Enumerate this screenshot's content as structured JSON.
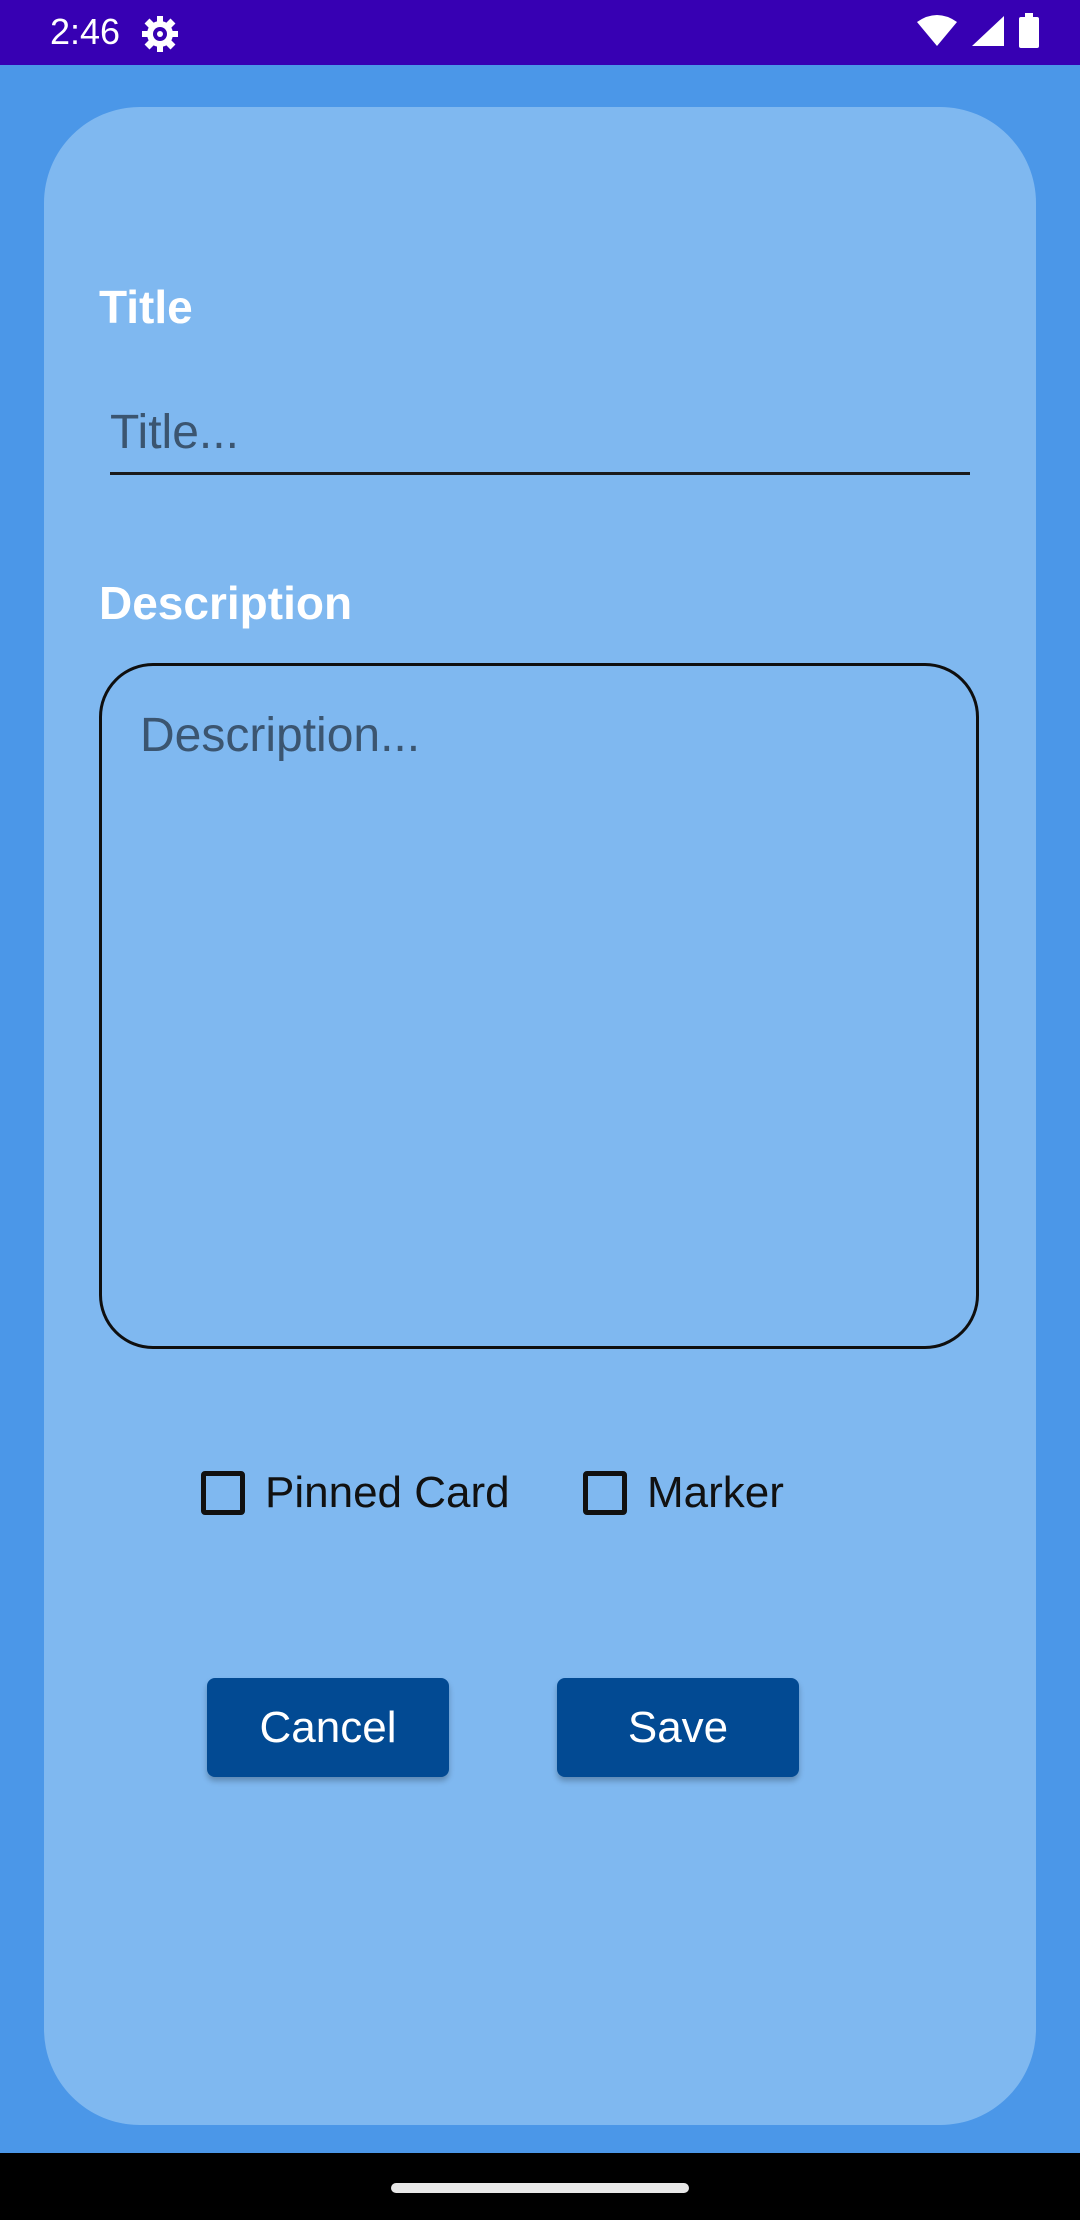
{
  "status_bar": {
    "time": "2:46",
    "background": "#3700b3",
    "icons": [
      "settings-gear-icon",
      "wifi-icon",
      "signal-icon",
      "battery-icon"
    ]
  },
  "form": {
    "title_label": "Title",
    "title_placeholder": "Title...",
    "title_value": "",
    "description_label": "Description",
    "description_placeholder": "Description...",
    "description_value": ""
  },
  "checkboxes": {
    "pinned_card": {
      "label": "Pinned Card",
      "checked": false
    },
    "marker": {
      "label": "Marker",
      "checked": false
    }
  },
  "buttons": {
    "cancel": "Cancel",
    "save": "Save"
  },
  "colors": {
    "background": "#4b97e8",
    "card": "#7fb8f0",
    "button": "#024a93",
    "status_bar": "#3700b3"
  }
}
